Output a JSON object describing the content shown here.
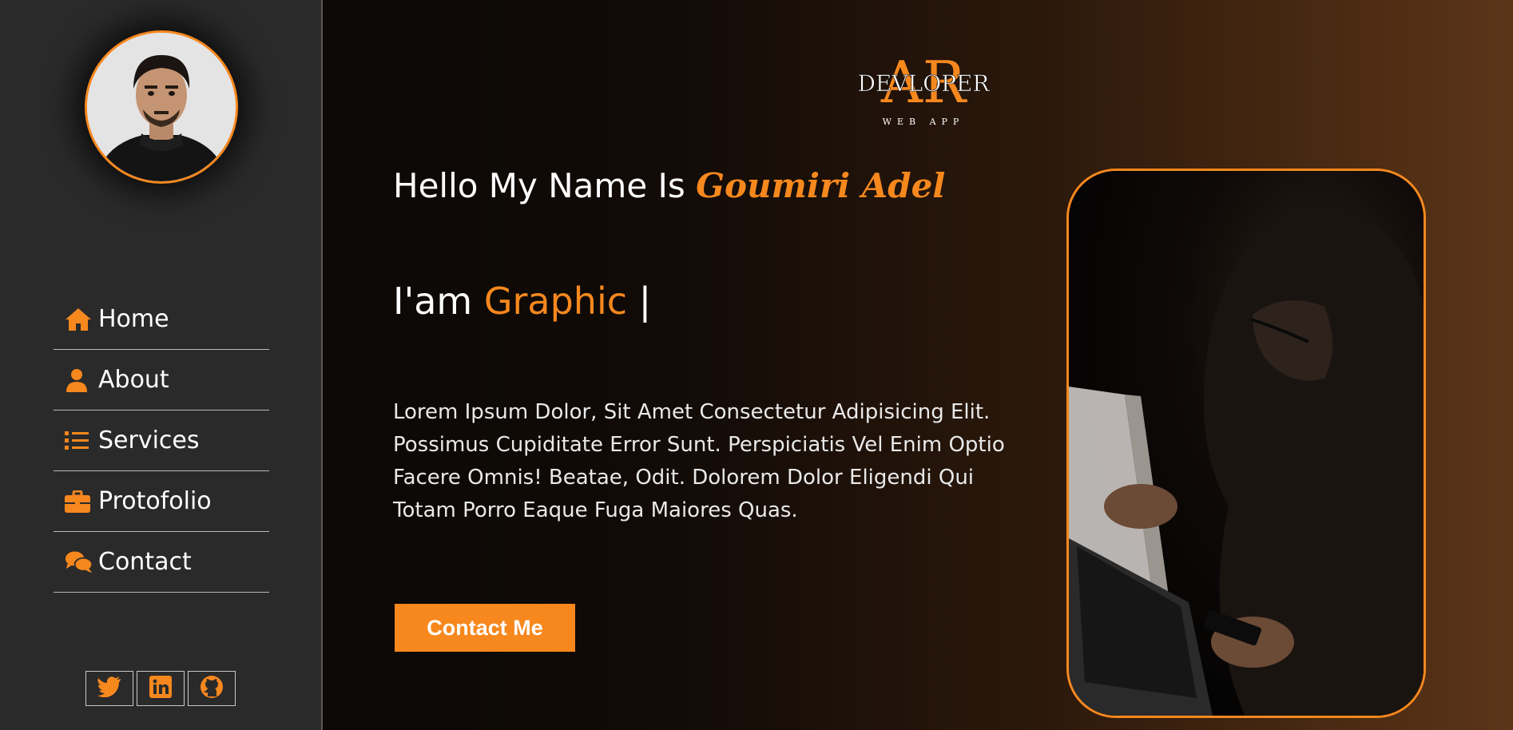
{
  "colors": {
    "accent": "#f7881e",
    "sidebar_bg": "#2a2a2a",
    "text": "#ffffff"
  },
  "sidebar": {
    "nav": [
      {
        "label": "Home",
        "icon": "home-icon"
      },
      {
        "label": "About",
        "icon": "user-icon"
      },
      {
        "label": "Services",
        "icon": "list-icon"
      },
      {
        "label": "Protofolio",
        "icon": "briefcase-icon"
      },
      {
        "label": "Contact",
        "icon": "chat-icon"
      }
    ],
    "social": [
      {
        "icon": "twitter-icon"
      },
      {
        "icon": "linkedin-icon"
      },
      {
        "icon": "github-icon"
      }
    ]
  },
  "logo": {
    "monogram": "AR",
    "word": "DEVLOPER",
    "tagline": "WEB APP"
  },
  "hero": {
    "greeting_prefix": "Hello My Name Is ",
    "name": "Goumiri Adel",
    "role_prefix": "I'am ",
    "role_word": "Graphic",
    "cursor": " |",
    "bio": "Lorem Ipsum Dolor, Sit Amet Consectetur Adipisicing Elit. Possimus Cupiditate Error Sunt. Perspiciatis Vel Enim Optio Facere Omnis! Beatae, Odit. Dolorem Dolor Eligendi Qui Totam Porro Eaque Fuga Maiores Quas.",
    "cta_label": "Contact Me"
  }
}
